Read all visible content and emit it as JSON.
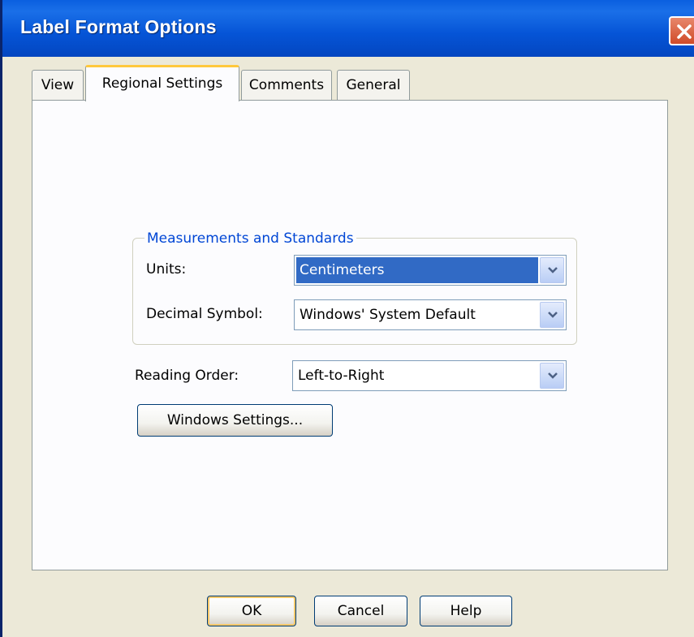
{
  "window": {
    "title": "Label Format Options"
  },
  "tabs": [
    {
      "label": "View"
    },
    {
      "label": "Regional Settings"
    },
    {
      "label": "Comments"
    },
    {
      "label": "General"
    }
  ],
  "active_tab": "Regional Settings",
  "measurements": {
    "group_title": "Measurements and Standards",
    "units_label": "Units:",
    "units_value": "Centimeters",
    "decimal_label": "Decimal Symbol:",
    "decimal_value": "Windows' System Default"
  },
  "reading_order": {
    "label": "Reading Order:",
    "value": "Left-to-Right"
  },
  "windows_settings_button": "Windows Settings...",
  "buttons": {
    "ok": "OK",
    "cancel": "Cancel",
    "help": "Help"
  },
  "colors": {
    "titlebar": "#0554D6",
    "selection": "#316AC5",
    "group_title": "#0046D5",
    "active_tab_accent": "#FFC83C",
    "close_button": "#D04A28"
  },
  "icons": {
    "close": "close-icon",
    "dropdown": "chevron-down-icon"
  }
}
